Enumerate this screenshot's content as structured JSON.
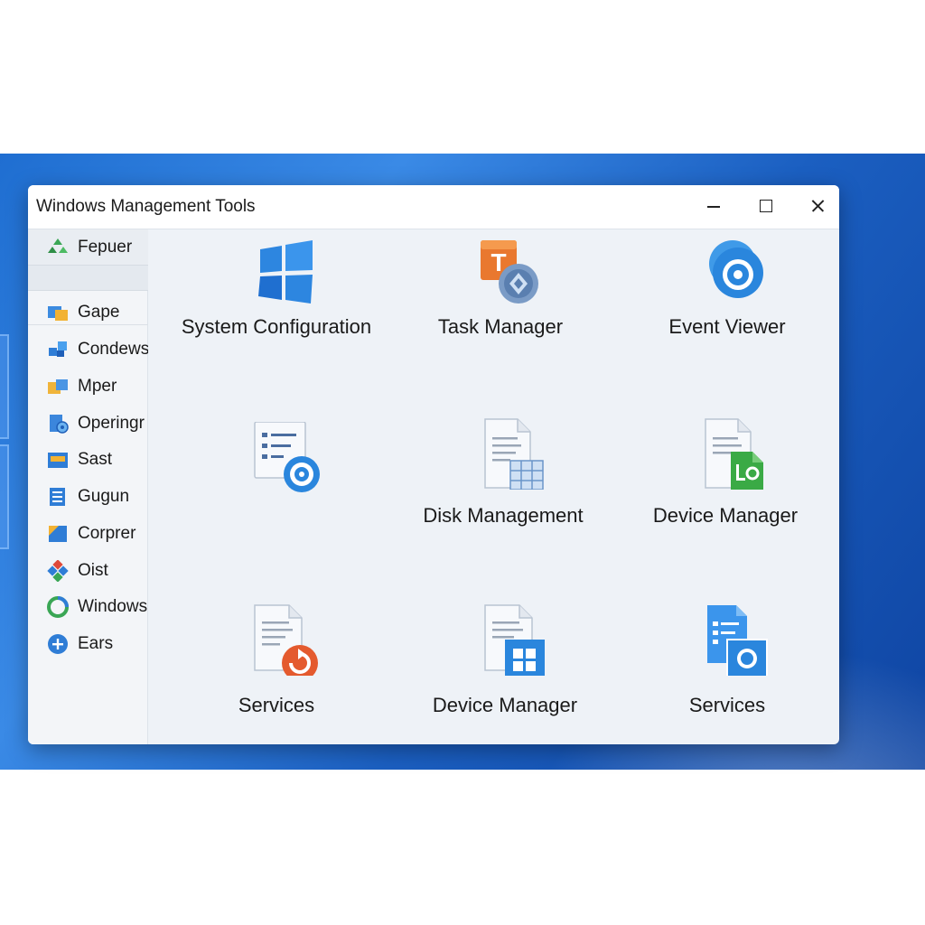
{
  "window": {
    "title": "Windows Management Tools"
  },
  "sidebar": {
    "top_item": {
      "label": "Fepuer",
      "icon": "green-cluster-icon"
    },
    "items": [
      {
        "label": "Gape",
        "icon": "folder-blue-icon"
      },
      {
        "label": "Condews",
        "icon": "network-icon"
      },
      {
        "label": "Mper",
        "icon": "folder-yellow-icon"
      },
      {
        "label": "Operingr",
        "icon": "document-gear-icon"
      },
      {
        "label": "Sast",
        "icon": "panel-icon"
      },
      {
        "label": "Gugun",
        "icon": "list-icon"
      },
      {
        "label": "Corprer",
        "icon": "window-icon"
      },
      {
        "label": "Oist",
        "icon": "diamond-grid-icon"
      },
      {
        "label": "Windows",
        "icon": "refresh-circle-icon"
      },
      {
        "label": "Ears",
        "icon": "plus-circle-icon"
      }
    ]
  },
  "tiles": [
    {
      "label": "System Configuration",
      "icon": "windows-logo-icon"
    },
    {
      "label": "Task Manager",
      "icon": "task-manager-icon"
    },
    {
      "label": "Event Viewer",
      "icon": "event-viewer-icon"
    },
    {
      "label": "",
      "icon": "list-gear-icon"
    },
    {
      "label": "Disk Management",
      "icon": "document-grid-icon"
    },
    {
      "label": "Device Manager",
      "icon": "document-green-icon"
    },
    {
      "label": "Services",
      "icon": "document-refresh-icon"
    },
    {
      "label": "Device Manager",
      "icon": "document-windows-icon"
    },
    {
      "label": "Services",
      "icon": "blue-document-gear-icon"
    }
  ],
  "colors": {
    "accent": "#1f6ed1",
    "window_bg": "#eef2f7"
  }
}
